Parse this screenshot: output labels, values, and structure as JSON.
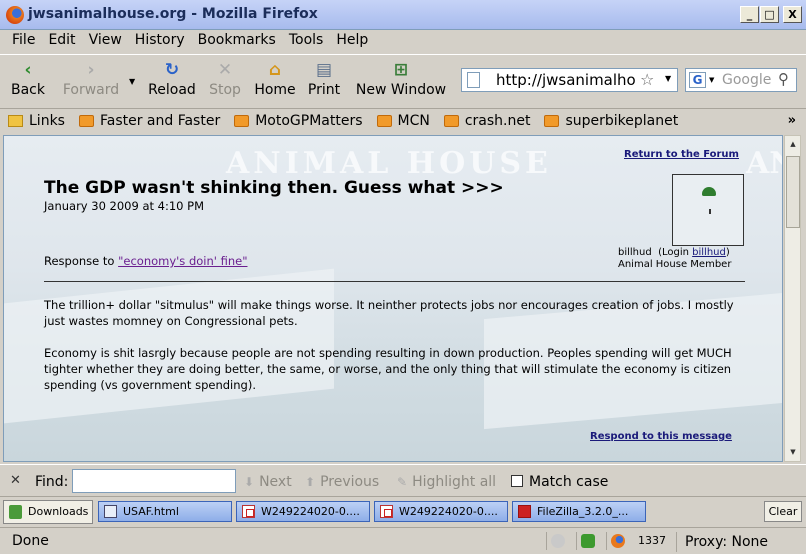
{
  "window": {
    "title": "jwsanimalhouse.org - Mozilla Firefox",
    "controls": {
      "minimize": "_",
      "maximize": "□",
      "close": "X"
    }
  },
  "menu": [
    "File",
    "Edit",
    "View",
    "History",
    "Bookmarks",
    "Tools",
    "Help"
  ],
  "toolbar": {
    "back": "Back",
    "forward": "Forward",
    "reload": "Reload",
    "stop": "Stop",
    "home": "Home",
    "print": "Print",
    "new_window": "New Window"
  },
  "address_bar": {
    "url": "http://jwsanimalho"
  },
  "search_bar": {
    "placeholder": "Google"
  },
  "bookmarks": [
    {
      "label": "Links",
      "icon": "folder-icon"
    },
    {
      "label": "Faster and Faster",
      "icon": "rss-icon"
    },
    {
      "label": "MotoGPMatters",
      "icon": "rss-icon"
    },
    {
      "label": "MCN",
      "icon": "rss-icon"
    },
    {
      "label": "crash.net",
      "icon": "rss-icon"
    },
    {
      "label": "superbikeplanet",
      "icon": "rss-icon"
    }
  ],
  "page": {
    "return_link": "Return to the Forum",
    "post_title": "The GDP wasn't shinking then. Guess what >>>",
    "post_date": "January 30 2009 at 4:10 PM",
    "user": {
      "name": "billhud",
      "login_prefix": "(Login ",
      "login_name": "billhud",
      "login_suffix": ")",
      "role": "Animal House Member"
    },
    "response_prefix": "Response to ",
    "response_link": "\"economy's doin' fine\"",
    "paragraphs": [
      "The trillion+ dollar \"sitmulus\" will make things worse. It neinther protects jobs nor encourages creation of jobs. I mostly just wastes momney on Congressional pets.",
      "Economy is shit lasrgly because people are not spending resulting in down production. Peoples spending will get MUCH tighter whether they are doing better, the same, or worse, and the only thing that will stimulate the economy is citizen spending (vs government spending)."
    ],
    "respond_link": "Respond to this message"
  },
  "find_bar": {
    "label": "Find:",
    "value": "",
    "next": "Next",
    "previous": "Previous",
    "highlight_all": "Highlight all",
    "match_case": "Match case"
  },
  "taskbar": {
    "downloads": "Downloads",
    "items": [
      "USAF.html",
      "W249224020-0....",
      "W249224020-0....",
      "FileZilla_3.2.0_..."
    ],
    "clear": "Clear"
  },
  "status_bar": {
    "status": "Done",
    "count": "1337",
    "proxy": "Proxy: None"
  }
}
